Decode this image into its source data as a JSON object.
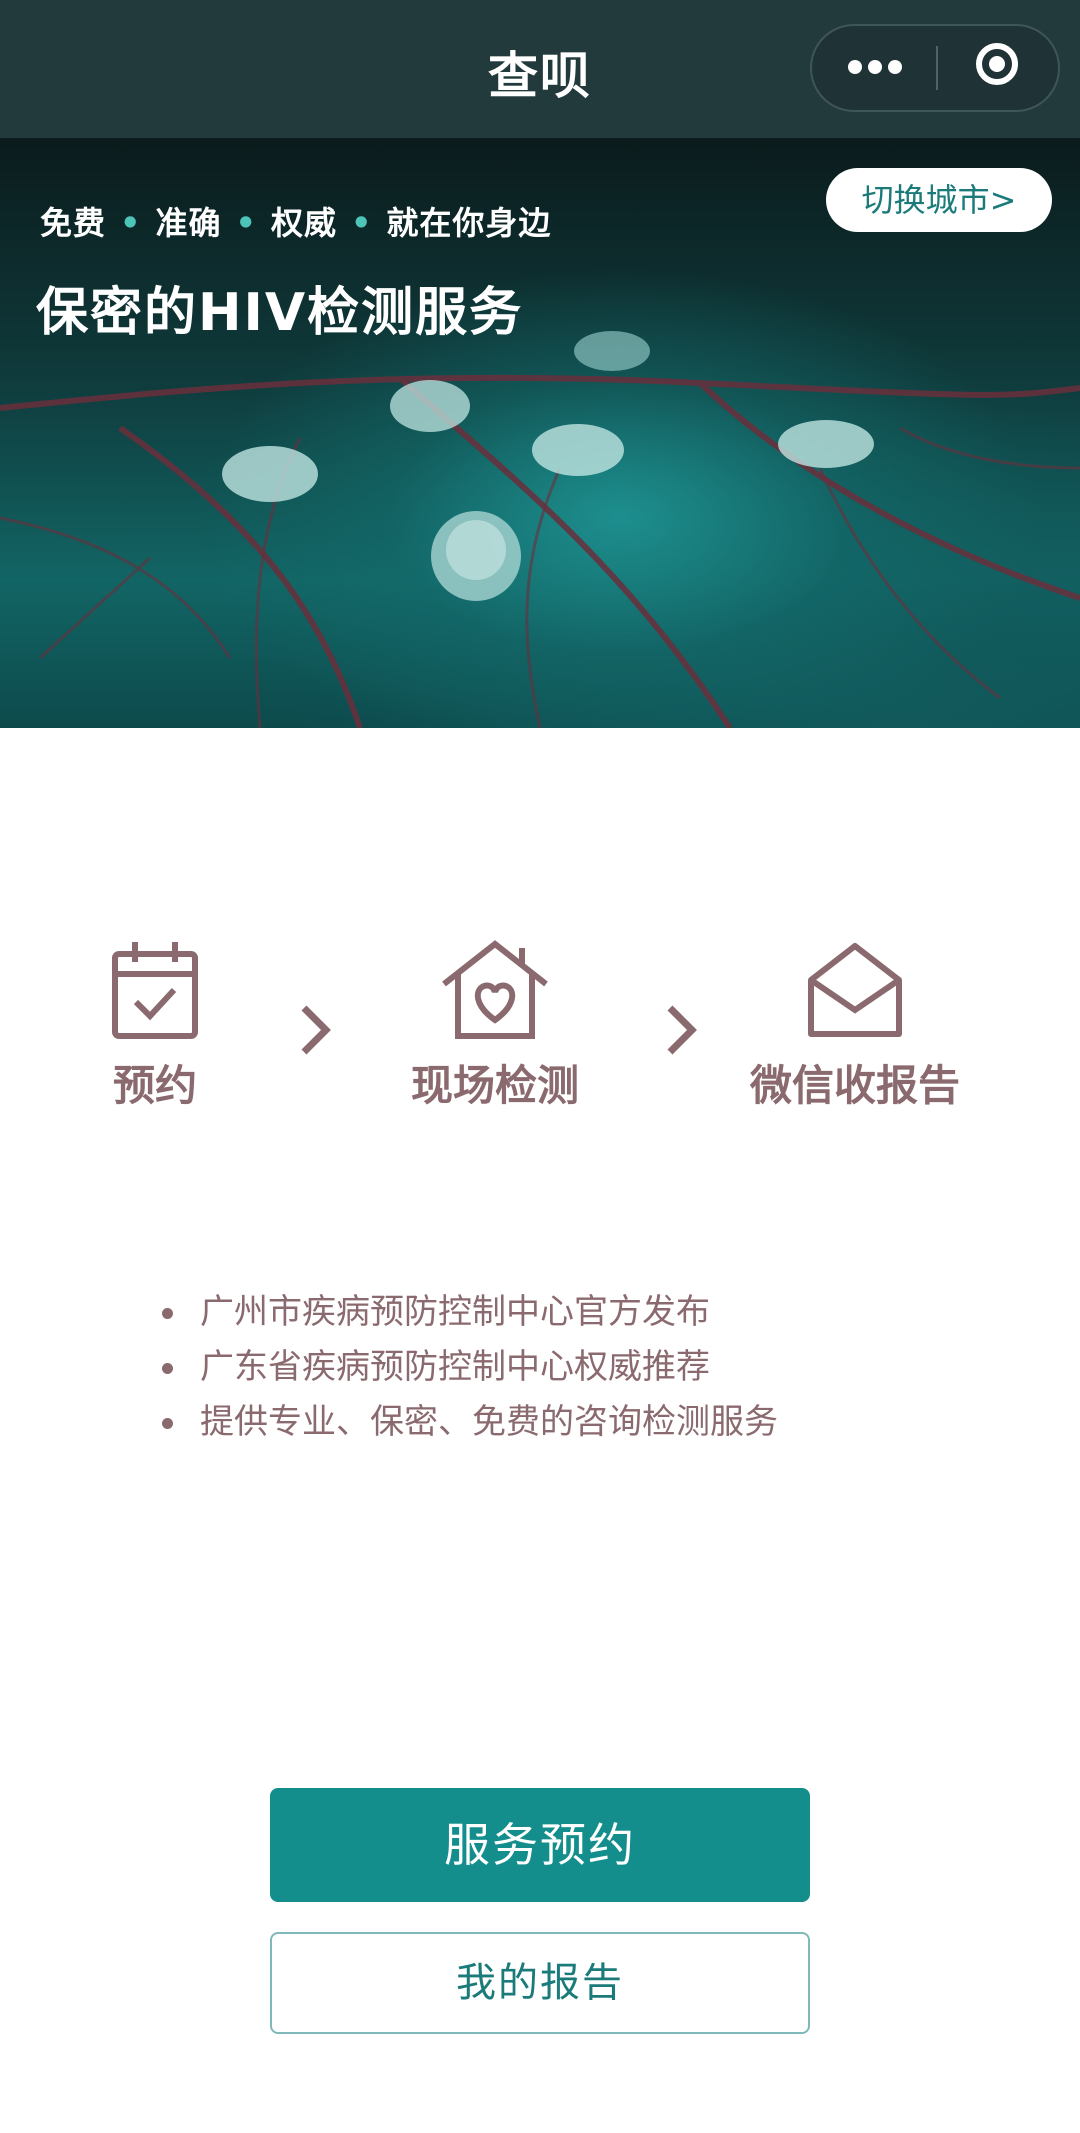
{
  "header": {
    "title": "查呗",
    "more_icon": "more-dots-icon",
    "close_icon": "target-icon"
  },
  "hero": {
    "tagline": [
      "免费",
      "准确",
      "权威",
      "就在你身边"
    ],
    "headline": "保密的HIV检测服务",
    "city_button": "切换城市>"
  },
  "steps": [
    {
      "label": "预约",
      "icon": "calendar-check-icon"
    },
    {
      "label": "现场检测",
      "icon": "house-heart-icon"
    },
    {
      "label": "微信收报告",
      "icon": "envelope-open-icon"
    }
  ],
  "bullets": [
    "广州市疾病预防控制中心官方发布",
    "广东省疾病预防控制中心权威推荐",
    "提供专业、保密、免费的咨询检测服务"
  ],
  "actions": {
    "primary": "服务预约",
    "secondary": "我的报告"
  },
  "colors": {
    "titlebar": "#233a3d",
    "accent": "#138e8c",
    "text_muted": "#8a6a6e"
  }
}
